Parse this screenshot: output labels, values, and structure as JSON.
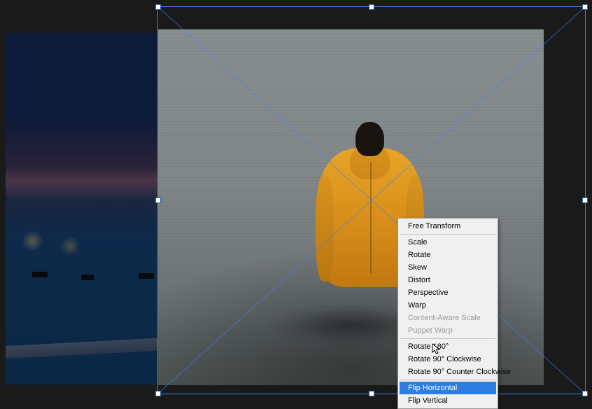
{
  "contextMenu": {
    "groups": [
      [
        {
          "key": "free-transform",
          "label": "Free Transform",
          "enabled": true
        }
      ],
      [
        {
          "key": "scale",
          "label": "Scale",
          "enabled": true
        },
        {
          "key": "rotate",
          "label": "Rotate",
          "enabled": true
        },
        {
          "key": "skew",
          "label": "Skew",
          "enabled": true
        },
        {
          "key": "distort",
          "label": "Distort",
          "enabled": true
        },
        {
          "key": "perspective",
          "label": "Perspective",
          "enabled": true
        },
        {
          "key": "warp",
          "label": "Warp",
          "enabled": true
        },
        {
          "key": "content-aware-scale",
          "label": "Content-Aware Scale",
          "enabled": false
        },
        {
          "key": "puppet-warp",
          "label": "Puppet Warp",
          "enabled": false
        }
      ],
      [
        {
          "key": "rotate-180",
          "label": "Rotate 180°",
          "enabled": true
        },
        {
          "key": "rotate-90-cw",
          "label": "Rotate 90° Clockwise",
          "enabled": true
        },
        {
          "key": "rotate-90-ccw",
          "label": "Rotate 90° Counter Clockwise",
          "enabled": true
        }
      ],
      [
        {
          "key": "flip-horizontal",
          "label": "Flip Horizontal",
          "enabled": true,
          "highlighted": true
        },
        {
          "key": "flip-vertical",
          "label": "Flip Vertical",
          "enabled": true
        }
      ]
    ]
  }
}
